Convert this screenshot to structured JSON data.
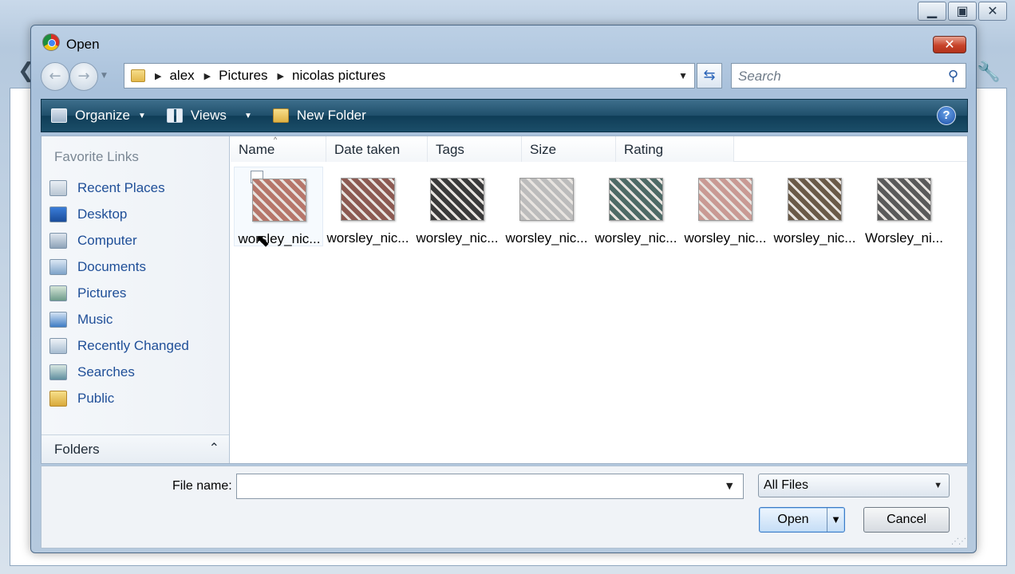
{
  "dialog": {
    "title": "Open",
    "close_symbol": "✕"
  },
  "address": {
    "crumbs": [
      "alex",
      "Pictures",
      "nicolas pictures"
    ]
  },
  "search": {
    "placeholder": "Search"
  },
  "toolbar": {
    "organize": "Organize",
    "views": "Views",
    "new_folder": "New Folder"
  },
  "nav_pane": {
    "favorites_header": "Favorite Links",
    "items": [
      {
        "label": "Recent Places",
        "icon": "recent-places-icon"
      },
      {
        "label": "Desktop",
        "icon": "desktop-icon"
      },
      {
        "label": "Computer",
        "icon": "computer-icon"
      },
      {
        "label": "Documents",
        "icon": "documents-icon"
      },
      {
        "label": "Pictures",
        "icon": "pictures-icon"
      },
      {
        "label": "Music",
        "icon": "music-icon"
      },
      {
        "label": "Recently Changed",
        "icon": "recently-changed-icon"
      },
      {
        "label": "Searches",
        "icon": "searches-icon"
      },
      {
        "label": "Public",
        "icon": "public-folder-icon"
      }
    ],
    "folders_label": "Folders"
  },
  "columns": [
    "Name",
    "Date taken",
    "Tags",
    "Size",
    "Rating"
  ],
  "files": [
    {
      "label": "worsley_nic...",
      "thumb": "#b6766a"
    },
    {
      "label": "worsley_nic...",
      "thumb": "#8c5a52"
    },
    {
      "label": "worsley_nic...",
      "thumb": "#3a3a3a"
    },
    {
      "label": "worsley_nic...",
      "thumb": "#bcbcbc"
    },
    {
      "label": "worsley_nic...",
      "thumb": "#4d6a66"
    },
    {
      "label": "worsley_nic...",
      "thumb": "#c99a94"
    },
    {
      "label": "worsley_nic...",
      "thumb": "#6a5a48"
    },
    {
      "label": "Worsley_ni...",
      "thumb": "#5a5a5a"
    }
  ],
  "bottom": {
    "file_name_label": "File name:",
    "file_name_value": "",
    "file_type": "All Files",
    "open_label": "Open",
    "cancel_label": "Cancel"
  }
}
